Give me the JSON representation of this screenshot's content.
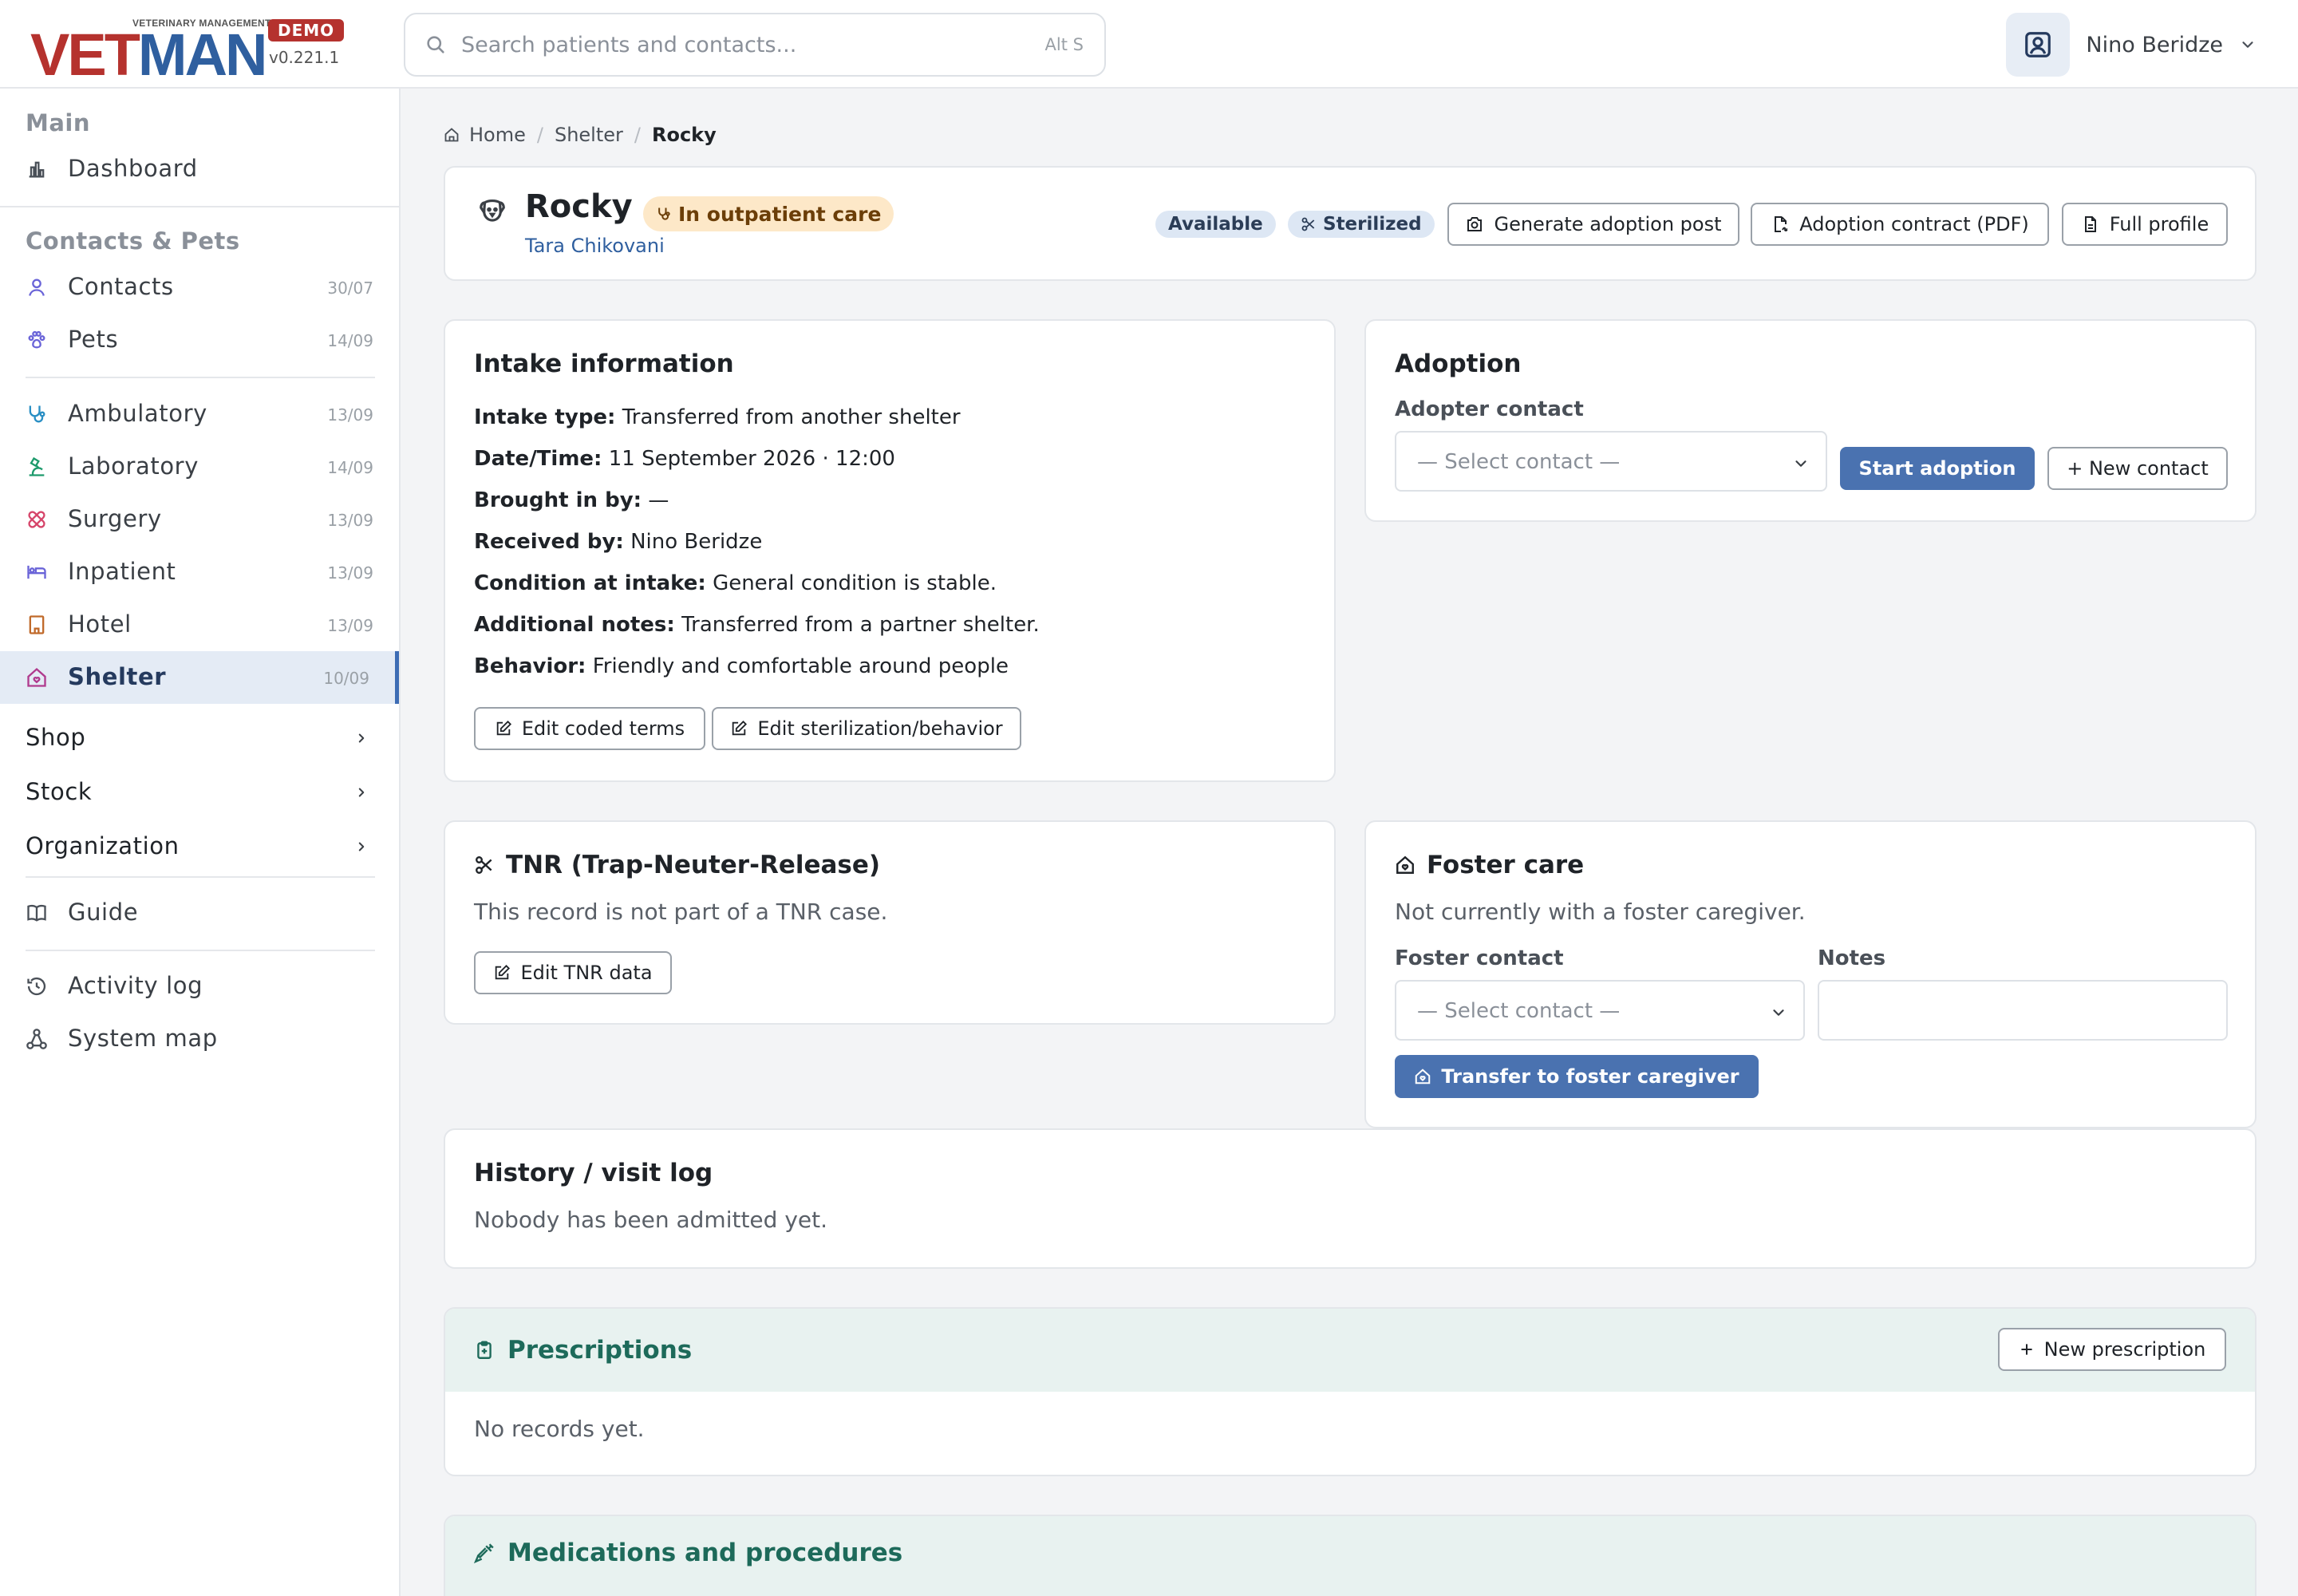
{
  "app": {
    "logo": "VETMAN",
    "logo_sub": "VETERINARY MANAGEMENT",
    "badge": "DEMO",
    "version": "v0.221.1"
  },
  "search": {
    "placeholder": "Search patients and contacts...",
    "shortcut": "Alt S"
  },
  "user": {
    "name": "Nino Beridze"
  },
  "sidebar": {
    "main_header": "Main",
    "dashboard": "Dashboard",
    "contacts_header": "Contacts & Pets",
    "items": [
      {
        "label": "Contacts",
        "date": "30/07"
      },
      {
        "label": "Pets",
        "date": "14/09"
      },
      {
        "label": "Ambulatory",
        "date": "13/09"
      },
      {
        "label": "Laboratory",
        "date": "14/09"
      },
      {
        "label": "Surgery",
        "date": "13/09"
      },
      {
        "label": "Inpatient",
        "date": "13/09"
      },
      {
        "label": "Hotel",
        "date": "13/09"
      },
      {
        "label": "Shelter",
        "date": "10/09"
      }
    ],
    "groups": [
      "Shop",
      "Stock",
      "Organization"
    ],
    "guide": "Guide",
    "activity_log": "Activity log",
    "system_map": "System map"
  },
  "breadcrumb": {
    "home": "Home",
    "section": "Shelter",
    "current": "Rocky"
  },
  "patient": {
    "name": "Rocky",
    "status": "In outpatient care",
    "owner": "Tara Chikovani",
    "badges": [
      "Available",
      "Sterilized"
    ],
    "actions": [
      "Generate adoption post",
      "Adoption contract (PDF)",
      "Full profile"
    ]
  },
  "intake": {
    "title": "Intake information",
    "rows": [
      {
        "key": "Intake type:",
        "value": "Transferred from another shelter"
      },
      {
        "key": "Date/Time:",
        "value": "11 September 2026 · 12:00"
      },
      {
        "key": "Brought in by:",
        "value": "—"
      },
      {
        "key": "Received by:",
        "value": "Nino Beridze"
      },
      {
        "key": "Condition at intake:",
        "value": "General condition is stable."
      },
      {
        "key": "Additional notes:",
        "value": "Transferred from a partner shelter."
      },
      {
        "key": "Behavior:",
        "value": "Friendly and comfortable around people"
      }
    ],
    "btn_coded": "Edit coded terms",
    "btn_steril": "Edit sterilization/behavior"
  },
  "adoption": {
    "title": "Adoption",
    "label": "Adopter contact",
    "select": "— Select contact —",
    "start": "Start adoption",
    "new_contact": "+ New contact"
  },
  "tnr": {
    "title": "TNR (Trap-Neuter-Release)",
    "text": "This record is not part of a TNR case.",
    "btn": "Edit TNR data"
  },
  "foster": {
    "title": "Foster care",
    "text": "Not currently with a foster caregiver.",
    "contact_label": "Foster contact",
    "notes_label": "Notes",
    "select": "— Select contact —",
    "notes_value": "",
    "transfer": "Transfer to foster caregiver"
  },
  "history": {
    "title": "History / visit log",
    "text": "Nobody has been admitted yet."
  },
  "prescriptions": {
    "title": "Prescriptions",
    "new": "New prescription",
    "empty": "No records yet."
  },
  "medications": {
    "title": "Medications and procedures"
  },
  "colors": {
    "accent": "#4a72b0",
    "brand_red": "#b5322e",
    "teal": "#1d6a5a",
    "active_bg": "#e4ebf5"
  }
}
